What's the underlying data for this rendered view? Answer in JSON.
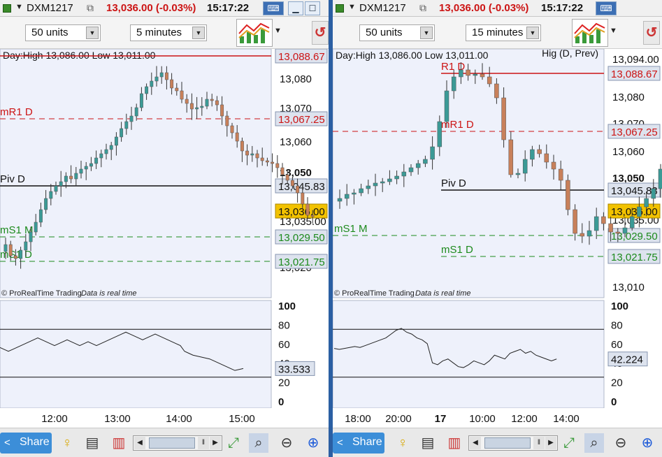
{
  "windows": [
    {
      "id": "left",
      "symbol": "DXM1217",
      "price_change": "13,036.00 (-0.03%)",
      "clock": "15:17:22",
      "units_select": "50 units",
      "timeframe_select": "5 minutes",
      "header_text": "Day:High 13,086.00 Low 13,011.00",
      "header_right": "",
      "copyright": "© ProRealTime Trading",
      "realtime_note": "Data is real time",
      "price_ticks": [
        "13,080",
        "13,070",
        "13,060",
        "13,050",
        "13,040",
        "13,035.00",
        "13,020"
      ],
      "level_labels": [
        {
          "name": "",
          "value": "13,088.67",
          "color": "#cc1414"
        },
        {
          "name": "mR1 D",
          "value": "13,067.25",
          "color": "#cc1414"
        },
        {
          "name": "Piv D",
          "value": "13,045.83",
          "color": "#111111"
        },
        {
          "name": "mS1 M",
          "value": "13,029.50",
          "color": "#1c8a1c"
        },
        {
          "name": "mS1 D",
          "value": "13,021.75",
          "color": "#1c8a1c"
        }
      ],
      "last_price": "13,036.00",
      "osc_ticks": [
        "100",
        "80",
        "60",
        "40",
        "20",
        "0"
      ],
      "osc_value": "33.533",
      "time_ticks": [
        "12:00",
        "13:00",
        "14:00",
        "15:00"
      ],
      "share_label": "Share"
    },
    {
      "id": "right",
      "symbol": "DXM1217",
      "price_change": "13,036.00 (-0.03%)",
      "clock": "15:17:22",
      "units_select": "50 units",
      "timeframe_select": "15 minutes",
      "header_text": "Day:High 13,086.00 Low 13,011.00",
      "header_right": "Hig (D, Prev)",
      "copyright": "© ProRealTime Trading",
      "realtime_note": "Data is real time",
      "price_ticks": [
        "13,094.00",
        "13,080",
        "13,070",
        "13,060",
        "13,050",
        "13,040",
        "13,035.00",
        "13,010"
      ],
      "level_labels": [
        {
          "name": "R1 D",
          "value": "13,088.67",
          "color": "#cc1414"
        },
        {
          "name": "mR1 D",
          "value": "13,067.25",
          "color": "#cc1414"
        },
        {
          "name": "Piv D",
          "value": "13,045.83",
          "color": "#111111"
        },
        {
          "name": "mS1 M",
          "value": "13,029.50",
          "color": "#1c8a1c"
        },
        {
          "name": "mS1 D",
          "value": "13,021.75",
          "color": "#1c8a1c"
        }
      ],
      "last_price": "13,036.00",
      "osc_ticks": [
        "100",
        "80",
        "60",
        "40",
        "20",
        "0"
      ],
      "osc_value": "42.224",
      "time_ticks": [
        "18:00",
        "20:00",
        "17",
        "10:00",
        "12:00",
        "14:00"
      ],
      "share_label": "Share"
    }
  ],
  "colors": {
    "up_candle": "#3b9a96",
    "down_candle": "#c8805a",
    "last_price_badge": "#f2c200",
    "plot_bg": "#eef1fb"
  }
}
